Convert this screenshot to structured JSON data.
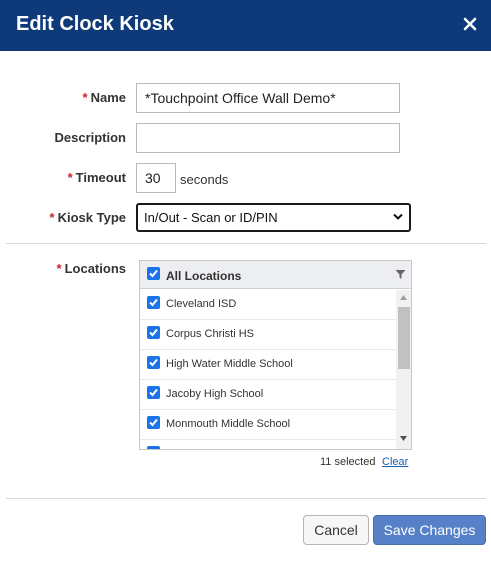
{
  "dialog": {
    "title": "Edit Clock Kiosk"
  },
  "form": {
    "required_mark": "*",
    "name": {
      "label": "Name",
      "value": "*Touchpoint Office Wall Demo*"
    },
    "description": {
      "label": "Description",
      "value": ""
    },
    "timeout": {
      "label": "Timeout",
      "value": "30",
      "unit": "seconds"
    },
    "kiosk_type": {
      "label": "Kiosk Type",
      "selected": "In/Out - Scan or ID/PIN"
    },
    "locations": {
      "label": "Locations",
      "header_label": "All Locations",
      "items": [
        {
          "label": "Cleveland ISD",
          "checked": true
        },
        {
          "label": "Corpus Christi HS",
          "checked": true
        },
        {
          "label": "High Water Middle School",
          "checked": true
        },
        {
          "label": "Jacoby High School",
          "checked": true
        },
        {
          "label": "Monmouth Middle School",
          "checked": true
        }
      ],
      "selected_count": "11 selected",
      "clear_label": "Clear"
    }
  },
  "footer": {
    "cancel_label": "Cancel",
    "save_label": "Save Changes"
  },
  "colors": {
    "header_bg": "#0f3a7a",
    "checkbox": "#1a73e8",
    "save_button": "#5680c7",
    "required": "#cc2222",
    "link": "#1a5fb4"
  },
  "icons": {
    "close": "close-icon",
    "filter": "filter-icon",
    "select_arrow": "chevron-down-icon",
    "checkbox": "checkmark-icon"
  }
}
